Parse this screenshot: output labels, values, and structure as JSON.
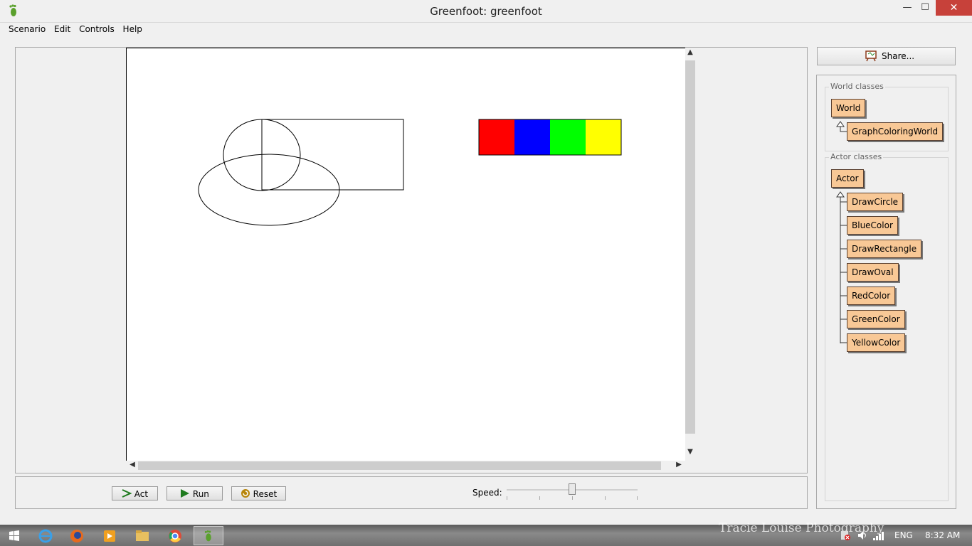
{
  "window": {
    "title": "Greenfoot: greenfoot",
    "minimize": "—",
    "maximize": "☐",
    "close": "✕"
  },
  "menu": [
    "Scenario",
    "Edit",
    "Controls",
    "Help"
  ],
  "world_colors": {
    "red": "#ff0000",
    "blue": "#0000ff",
    "green": "#00ff00",
    "yellow": "#ffff00"
  },
  "controls": {
    "act_label": "Act",
    "run_label": "Run",
    "reset_label": "Reset",
    "speed_label": "Speed:",
    "speed_value": 0.5
  },
  "share_label": "Share...",
  "world_classes": {
    "label": "World classes",
    "root": "World",
    "children": [
      "GraphColoringWorld"
    ]
  },
  "actor_classes": {
    "label": "Actor classes",
    "root": "Actor",
    "children": [
      "DrawCircle",
      "BlueColor",
      "DrawRectangle",
      "DrawOval",
      "RedColor",
      "GreenColor",
      "YellowColor"
    ]
  },
  "taskbar": {
    "watermark": "Tracie Louise Photography",
    "lang": "ENG",
    "time": "8:32 AM"
  }
}
